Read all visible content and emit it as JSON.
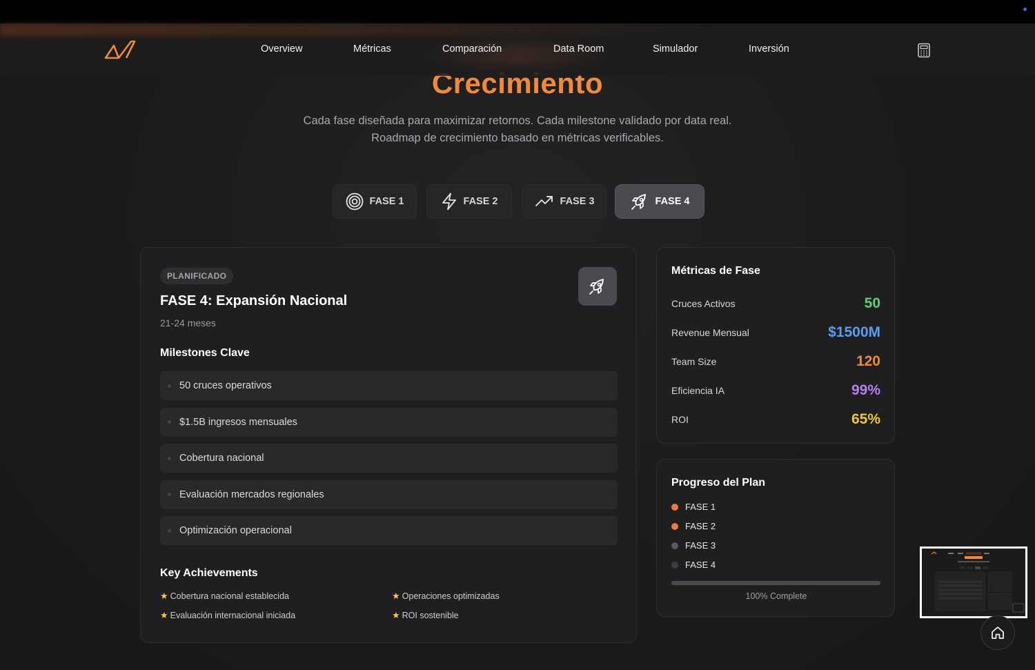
{
  "nav": {
    "logo_icon": "brand-logo",
    "links": [
      "Overview",
      "Métricas",
      "Comparación",
      "Data Room",
      "Simulador",
      "Inversión"
    ],
    "calculator_icon": "calculator-icon"
  },
  "hero": {
    "title": "Crecimiento",
    "subtitle_line1": "Cada fase diseñada para maximizar retornos. Cada milestone validado por data real.",
    "subtitle_line2": "Roadmap de crecimiento basado en métricas verificables."
  },
  "tabs": [
    {
      "label": "FASE 1",
      "icon": "target-icon",
      "active": false
    },
    {
      "label": "FASE 2",
      "icon": "bolt-icon",
      "active": false
    },
    {
      "label": "FASE 3",
      "icon": "trending-up-icon",
      "active": false
    },
    {
      "label": "FASE 4",
      "icon": "rocket-icon",
      "active": true
    }
  ],
  "phase": {
    "status": "PLANIFICADO",
    "title": "FASE 4: Expansión Nacional",
    "duration": "21-24 meses",
    "icon": "rocket-icon",
    "milestones_title": "Milestones Clave",
    "milestones": [
      "50 cruces operativos",
      "$1.5B ingresos mensuales",
      "Cobertura nacional",
      "Evaluación mercados regionales",
      "Optimización operacional"
    ],
    "achievements_title": "Key Achievements",
    "achievements": [
      "Cobertura nacional establecida",
      "Operaciones optimizadas",
      "Evaluación internacional iniciada",
      "ROI sostenible"
    ]
  },
  "metrics": {
    "title": "Métricas de Fase",
    "rows": [
      {
        "label": "Cruces Activos",
        "value": "50",
        "color": "#5ccf7a"
      },
      {
        "label": "Revenue Mensual",
        "value": "$1500M",
        "color": "#5b9cf0"
      },
      {
        "label": "Team Size",
        "value": "120",
        "color": "#f08a3c"
      },
      {
        "label": "Eficiencia IA",
        "value": "99%",
        "color": "#b77ef0"
      },
      {
        "label": "ROI",
        "value": "65%",
        "color": "#f0c53c"
      }
    ]
  },
  "progress": {
    "title": "Progreso del Plan",
    "phases": [
      {
        "label": "FASE 1",
        "color": "#f07a3a"
      },
      {
        "label": "FASE 2",
        "color": "#f07a3a"
      },
      {
        "label": "FASE 3",
        "color": "#5a5a5e"
      },
      {
        "label": "FASE 4",
        "color": "#3e3e42"
      }
    ],
    "percent": 100,
    "label": "100% Complete"
  },
  "floating": {
    "home_icon": "home-icon",
    "minimap": "page-minimap"
  },
  "colors": {
    "accent": "#f08a3c",
    "background": "#1a1a1b"
  }
}
